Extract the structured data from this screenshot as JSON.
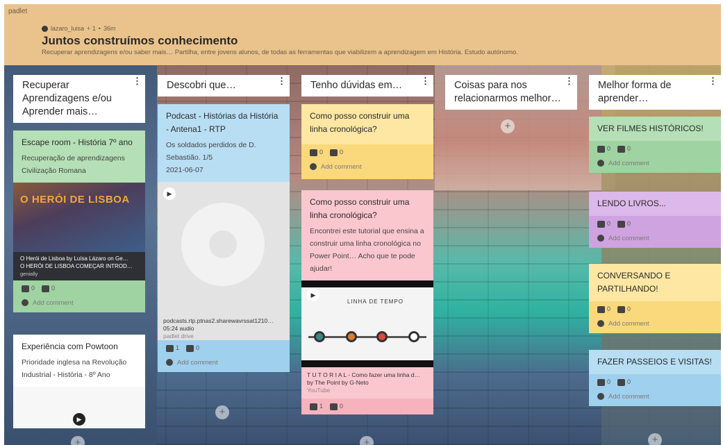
{
  "header": {
    "brand": "padlet",
    "author": "lazaro_luisa",
    "likes": "+ 1",
    "age": "36m",
    "title": "Juntos construímos conhecimento",
    "subtitle": "Recuperar aprendizagens e/ou saber mais… Partilha, entre jovens alunos, de todas as ferramentas que viabilizem a aprendizagem em História. Estudo autónomo."
  },
  "columns": [
    {
      "title": "Recuperar Aprendizagens e/ou Aprender mais…"
    },
    {
      "title": "Descobri que…"
    },
    {
      "title": "Tenho dúvidas em…"
    },
    {
      "title": "Coisas para nos relacionarmos melhor…"
    },
    {
      "title": "Melhor forma de aprender…"
    }
  ],
  "cards": {
    "escape": {
      "title": "Escape room - História 7º ano",
      "text": "Recuperação de aprendizagens Civilização Romana",
      "thumb_text": "O HERÓI DE LISBOA",
      "media_line1": "O Herói de Lisboa by Luísa Lázaro on Ge…",
      "media_line2": "O HERÓI DE LISBOA COMEÇAR INTROD…",
      "media_source": "genially",
      "likes": "0",
      "dislikes": "0",
      "comment": "Add comment"
    },
    "powtoon": {
      "title": "Experiência com Powtoon",
      "text": "Prioridade inglesa na Revolução Industrial - História - 8º Ano"
    },
    "podcast": {
      "title": "Podcast - Histórias da História - Antena1 - RTP",
      "text1": "Os soldados perdidos de D. Sebastião. 1/5",
      "text2": "2021-06-07",
      "file": "podcasts.rtp.ptnas2.sharewavrssat1210…",
      "duration": "05:24 audio",
      "source": "padlet drive",
      "likes": "1",
      "dislikes": "0",
      "comment": "Add comment"
    },
    "duvida1": {
      "title": "Como posso construir uma linha cronológica?",
      "likes": "0",
      "dislikes": "0",
      "comment": "Add comment"
    },
    "duvida2": {
      "title": "Como posso construir uma linha cronológica?",
      "text": "Encontrei este tutorial que ensina a construir uma linha cronológica no Power Point… Acho que te pode ajudar!",
      "timeline_label": "LINHA DE TEMPO",
      "media_title": "T U T O R I A L - Como fazer uma linha d…",
      "media_author": "by The Point by G-Neto",
      "media_source": "YouTube",
      "likes": "1",
      "dislikes": "0"
    },
    "filmes": {
      "title": "VER FILMES HISTÓRICOS!",
      "likes": "0",
      "dislikes": "0",
      "comment": "Add comment"
    },
    "livros": {
      "title": "LENDO LIVROS...",
      "likes": "0",
      "dislikes": "0",
      "comment": "Add comment"
    },
    "conversando": {
      "title": "CONVERSANDO E PARTILHANDO!",
      "likes": "0",
      "dislikes": "0",
      "comment": "Add comment"
    },
    "passeios": {
      "title": "FAZER PASSEIOS E VISITAS!",
      "likes": "0",
      "dislikes": "0",
      "comment": "Add comment"
    }
  },
  "add_button": "+",
  "menu_glyph": "⋮"
}
